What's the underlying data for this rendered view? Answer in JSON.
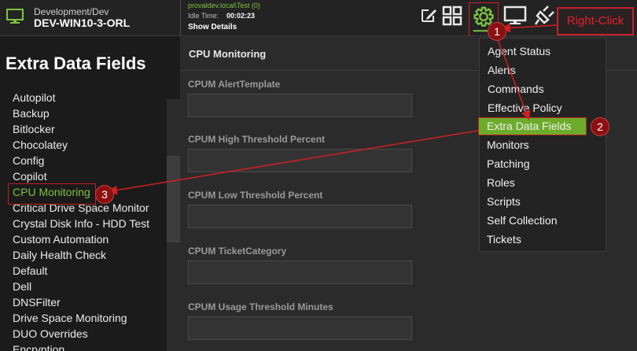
{
  "header": {
    "machine_path": "Development/Dev",
    "machine_name": "DEV-WIN10-3-ORL",
    "user": "provaldev.local\\Test (0)",
    "idle_label": "Idle Time:",
    "idle_value": "00:02:23",
    "show_details": "Show Details",
    "right_click_label": "Right-Click"
  },
  "sidebar": {
    "title": "Extra Data Fields",
    "items": [
      {
        "label": "Autopilot"
      },
      {
        "label": "Backup"
      },
      {
        "label": "Bitlocker"
      },
      {
        "label": "Chocolatey"
      },
      {
        "label": "Config"
      },
      {
        "label": "Copilot"
      },
      {
        "label": "CPU Monitoring"
      },
      {
        "label": "Critical Drive Space Monitor"
      },
      {
        "label": "Crystal Disk Info - HDD Test"
      },
      {
        "label": "Custom Automation"
      },
      {
        "label": "Daily Health Check"
      },
      {
        "label": "Default"
      },
      {
        "label": "Dell"
      },
      {
        "label": "DNSFilter"
      },
      {
        "label": "Drive Space Monitoring"
      },
      {
        "label": "DUO Overrides"
      },
      {
        "label": "Encryption"
      }
    ]
  },
  "main": {
    "title": "CPU Monitoring",
    "fields": [
      {
        "label": "CPUM AlertTemplate",
        "value": ""
      },
      {
        "label": "CPUM High Threshold Percent",
        "value": ""
      },
      {
        "label": "CPUM Low Threshold Percent",
        "value": ""
      },
      {
        "label": "CPUM TicketCategory",
        "value": ""
      },
      {
        "label": "CPUM Usage Threshold Minutes",
        "value": ""
      }
    ]
  },
  "menu": {
    "items": [
      {
        "label": "Agent Status"
      },
      {
        "label": "Alerts"
      },
      {
        "label": "Commands"
      },
      {
        "label": "Effective Policy"
      },
      {
        "label": "Extra Data Fields"
      },
      {
        "label": "Monitors"
      },
      {
        "label": "Patching"
      },
      {
        "label": "Roles"
      },
      {
        "label": "Scripts"
      },
      {
        "label": "Self Collection"
      },
      {
        "label": "Tickets"
      }
    ]
  },
  "markers": [
    "1",
    "2",
    "3"
  ],
  "colors": {
    "accent_green": "#7ec242",
    "highlight_green": "#6cac2a",
    "annotation_red": "#c8202a"
  }
}
